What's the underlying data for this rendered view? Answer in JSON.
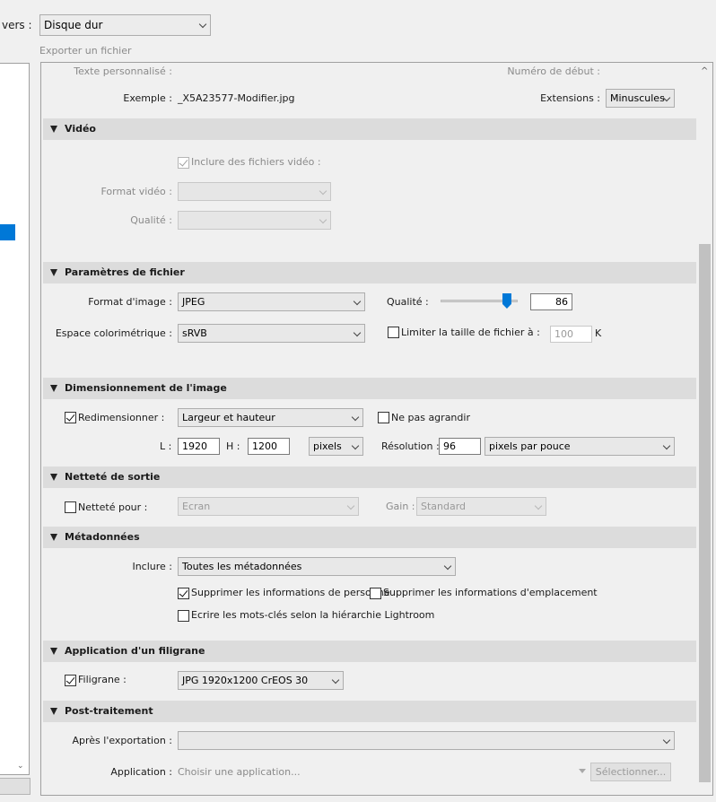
{
  "top": {
    "dest_label": "vers :",
    "dest_value": "Disque dur",
    "subtitle": "Exporter un fichier"
  },
  "naming": {
    "custom_text_label": "Texte personnalisé :",
    "start_number_label": "Numéro de début :",
    "example_label": "Exemple :",
    "example_value": "_X5A23577-Modifier.jpg",
    "extensions_label": "Extensions :",
    "extensions_value": "Minuscules"
  },
  "video": {
    "title": "Vidéo",
    "include_label": "Inclure des fichiers vidéo :",
    "include_checked": true,
    "format_label": "Format vidéo :",
    "quality_label": "Qualité :"
  },
  "file": {
    "title": "Paramètres de fichier",
    "format_label": "Format d'image :",
    "format_value": "JPEG",
    "quality_label": "Qualité :",
    "quality_value": "86",
    "quality_fraction": 0.86,
    "colorspace_label": "Espace colorimétrique :",
    "colorspace_value": "sRVB",
    "limit_label": "Limiter la taille de fichier à :",
    "limit_value": "100",
    "limit_unit": "K"
  },
  "sizing": {
    "title": "Dimensionnement de l'image",
    "resize_label": "Redimensionner :",
    "resize_value": "Largeur et hauteur",
    "no_enlarge_label": "Ne pas agrandir",
    "w_label": "L :",
    "w_value": "1920",
    "h_label": "H :",
    "h_value": "1200",
    "unit_value": "pixels",
    "resolution_label": "Résolution :",
    "resolution_value": "96",
    "resolution_unit": "pixels par pouce"
  },
  "sharpen": {
    "title": "Netteté de sortie",
    "for_label": "Netteté pour :",
    "for_value": "Ecran",
    "gain_label": "Gain :",
    "gain_value": "Standard"
  },
  "metadata": {
    "title": "Métadonnées",
    "include_label": "Inclure :",
    "include_value": "Toutes les métadonnées",
    "remove_person_label": "Supprimer les informations de personne",
    "remove_location_label": "Supprimer les informations d'emplacement",
    "hierarchy_label": "Ecrire les mots-clés selon la hiérarchie Lightroom"
  },
  "watermark": {
    "title": "Application d'un filigrane",
    "label": "Filigrane :",
    "value": "JPG 1920x1200 CrEOS 30"
  },
  "post": {
    "title": "Post-traitement",
    "after_label": "Après l'exportation :",
    "app_label": "Application :",
    "app_placeholder": "Choisir une application...",
    "choose_button": "Sélectionner..."
  },
  "colors": {
    "accent": "#0078d7",
    "header_bg": "#dcdcdc",
    "panel_bg": "#f0f0f0"
  }
}
